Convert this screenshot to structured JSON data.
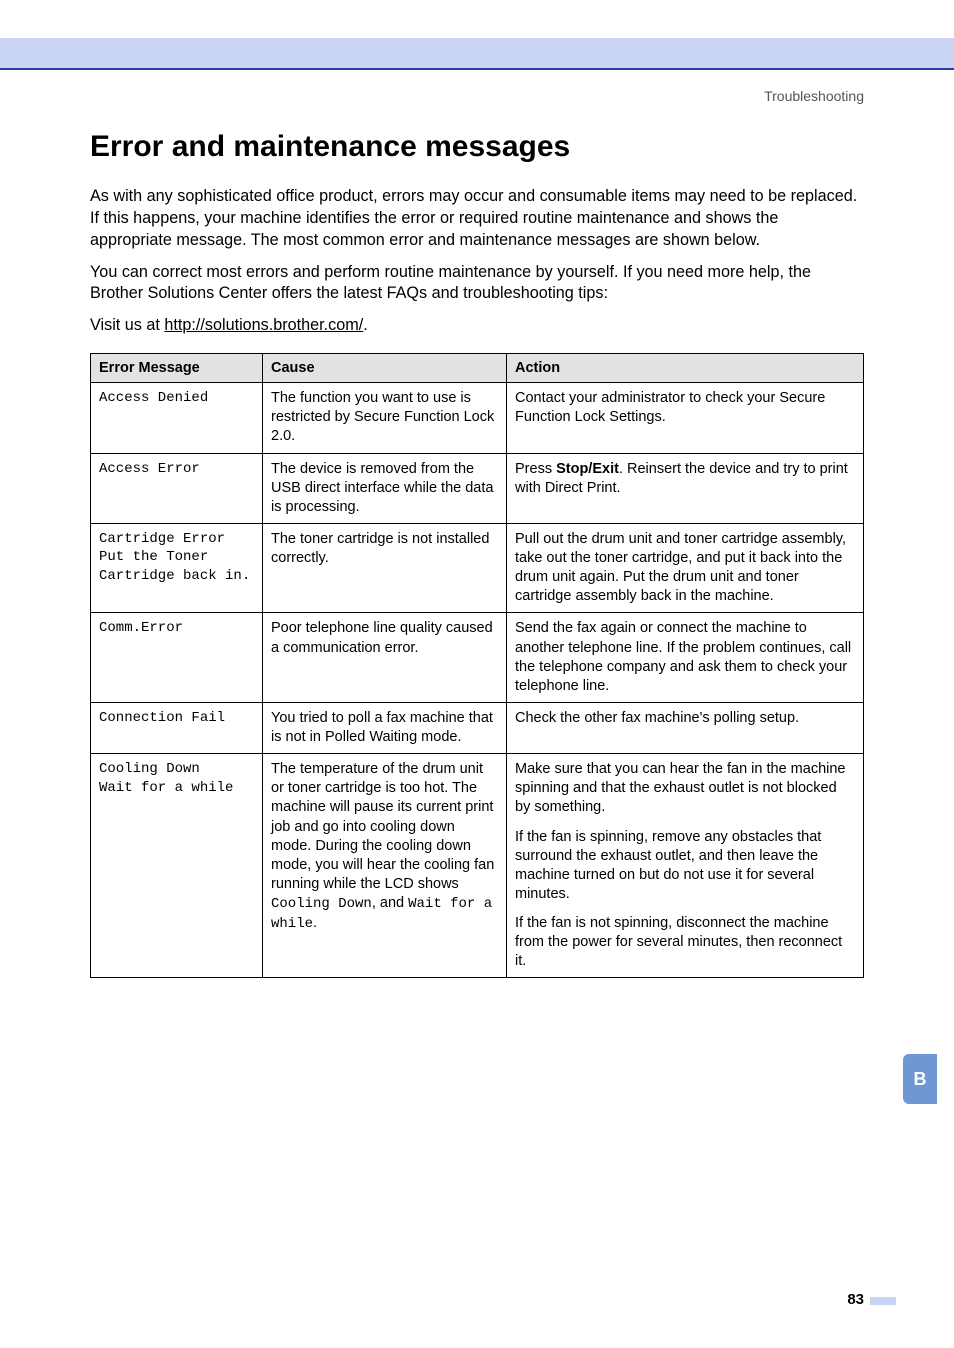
{
  "breadcrumb": "Troubleshooting",
  "heading": "Error and maintenance messages",
  "intro_p1": "As with any sophisticated office product, errors may occur and consumable items may need to be replaced. If this happens, your machine identifies the error or required routine maintenance and shows the appropriate message. The most common error and maintenance messages are shown below.",
  "intro_p2": "You can correct most errors and perform routine maintenance by yourself. If you need more help, the Brother Solutions Center offers the latest FAQs and troubleshooting tips:",
  "intro_p3_prefix": "Visit us at ",
  "intro_p3_link": "http://solutions.brother.com/",
  "intro_p3_suffix": ".",
  "table": {
    "headers": {
      "c1": "Error Message",
      "c2": "Cause",
      "c3": "Action"
    },
    "rows": [
      {
        "msg": "Access Denied",
        "cause": "The function you want to use is restricted by Secure Function Lock 2.0.",
        "action": "Contact your administrator to check your Secure Function Lock Settings."
      },
      {
        "msg": "Access Error",
        "cause": "The device is removed from the USB direct interface while the data is processing.",
        "action_html": "Press <b>Stop/Exit</b>. Reinsert the device and try to print with Direct Print."
      },
      {
        "msg": "Cartridge Error\nPut the Toner Cartridge back in.",
        "cause": "The toner cartridge is not installed correctly.",
        "action": "Pull out the drum unit and toner cartridge assembly, take out the toner cartridge, and put it back into the drum unit again. Put the drum unit and toner cartridge assembly back in the machine."
      },
      {
        "msg": "Comm.Error",
        "cause": "Poor telephone line quality caused a communication error.",
        "action": "Send the fax again or connect the machine to another telephone line. If the problem continues, call the telephone company and ask them to check your telephone line."
      },
      {
        "msg": "Connection Fail",
        "cause": "You tried to poll a fax machine that is not in Polled Waiting mode.",
        "action": "Check the other fax machine's polling setup."
      },
      {
        "msg": "Cooling Down\nWait for a while",
        "cause_mixed": {
          "pre": "The temperature of the drum unit or toner cartridge is too hot. The machine will pause its current print job and go into cooling down mode. During the cooling down mode, you will hear the cooling fan running while the LCD shows ",
          "m1": "Cooling Down",
          "mid1": ", and ",
          "m2": "Wait for a while",
          "post": "."
        },
        "action_paragraphs": [
          "Make sure that you can hear the fan in the machine spinning and that the exhaust outlet is not blocked by something.",
          "If the fan is spinning, remove any obstacles that surround the exhaust outlet, and then leave the machine turned on but do not use it for several minutes.",
          "If the fan is not spinning, disconnect the machine from the power for several minutes, then reconnect it."
        ]
      }
    ]
  },
  "side_tab": "B",
  "page_number": "83"
}
